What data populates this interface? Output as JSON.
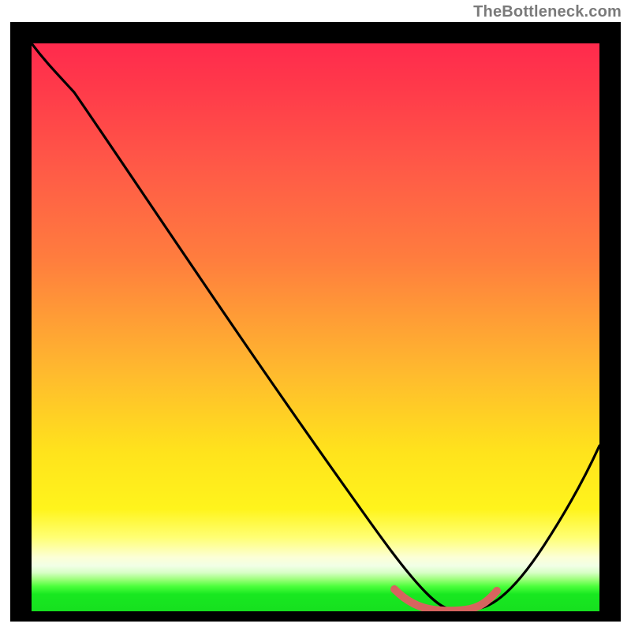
{
  "watermark": {
    "text": "TheBottleneck.com"
  },
  "chart_data": {
    "type": "line",
    "title": "",
    "xlabel": "",
    "ylabel": "",
    "xlim": [
      0,
      100
    ],
    "ylim": [
      0,
      100
    ],
    "grid": false,
    "legend": "none",
    "background_gradient_stops": [
      {
        "pos": 0,
        "color": "#ff2a4d"
      },
      {
        "pos": 8,
        "color": "#ff3a4a"
      },
      {
        "pos": 22,
        "color": "#ff5a47"
      },
      {
        "pos": 38,
        "color": "#ff7d3e"
      },
      {
        "pos": 58,
        "color": "#ffba2e"
      },
      {
        "pos": 72,
        "color": "#ffe31c"
      },
      {
        "pos": 82,
        "color": "#fff41c"
      },
      {
        "pos": 87,
        "color": "#ffff74"
      },
      {
        "pos": 90.5,
        "color": "#fcffd6"
      },
      {
        "pos": 92,
        "color": "#f1ffe6"
      },
      {
        "pos": 93.2,
        "color": "#d7ffc6"
      },
      {
        "pos": 94.4,
        "color": "#9cff7a"
      },
      {
        "pos": 95.6,
        "color": "#4dff3c"
      },
      {
        "pos": 97,
        "color": "#18e820"
      },
      {
        "pos": 100,
        "color": "#16e01f"
      }
    ],
    "series": [
      {
        "name": "bottleneck-curve",
        "color": "#000000",
        "x": [
          0,
          5,
          10,
          20,
          30,
          40,
          50,
          60,
          64,
          68,
          72,
          76,
          80,
          84,
          88,
          92,
          100
        ],
        "y": [
          100,
          95,
          90,
          76,
          62,
          48,
          34,
          20,
          11,
          5,
          1,
          0,
          0,
          2,
          7,
          14,
          30
        ]
      },
      {
        "name": "optimal-band",
        "color": "#d7645f",
        "x": [
          63,
          66,
          70,
          74,
          78,
          81
        ],
        "y": [
          4,
          2,
          0.5,
          0.5,
          2,
          4
        ]
      }
    ],
    "annotations": []
  }
}
